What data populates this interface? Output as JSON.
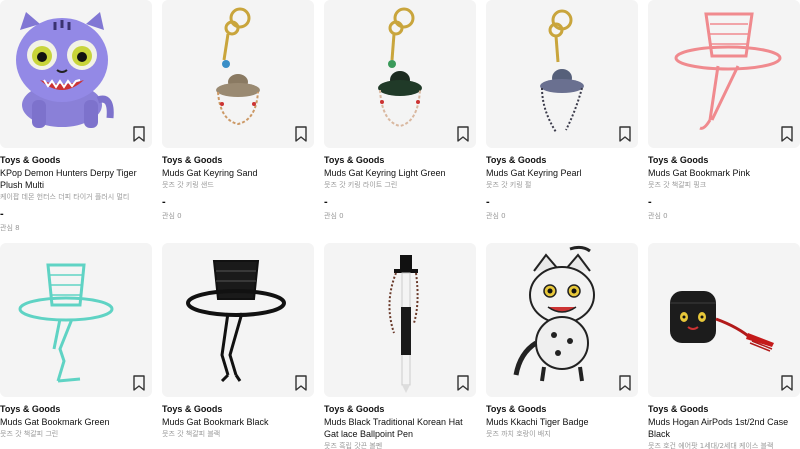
{
  "products": [
    {
      "category": "Toys & Goods",
      "name": "KPop Demon Hunters Derpy Tiger Plush Multi",
      "name_ko": "케이팝 데몬 헌터스 더피 타이거 플러시 멀티",
      "price": "-",
      "interest": "관심 8",
      "icon": "tiger-plush"
    },
    {
      "category": "Toys & Goods",
      "name": "Muds Gat Keyring Sand",
      "name_ko": "뭇즈 갓 키링 샌드",
      "price": "-",
      "interest": "관심 0",
      "icon": "gat-keyring"
    },
    {
      "category": "Toys & Goods",
      "name": "Muds Gat Keyring Light Green",
      "name_ko": "뭇즈 갓 키링 라이트 그린",
      "price": "-",
      "interest": "관심 0",
      "icon": "gat-keyring"
    },
    {
      "category": "Toys & Goods",
      "name": "Muds Gat Keyring Pearl",
      "name_ko": "뭇즈 갓 키링 펄",
      "price": "-",
      "interest": "관심 0",
      "icon": "gat-keyring"
    },
    {
      "category": "Toys & Goods",
      "name": "Muds Gat Bookmark Pink",
      "name_ko": "뭇즈 갓 책갈피 핑크",
      "price": "-",
      "interest": "관심 0",
      "icon": "gat-bookmark",
      "color": "#f08a8e"
    },
    {
      "category": "Toys & Goods",
      "name": "Muds Gat Bookmark Green",
      "name_ko": "뭇즈 갓 책갈피 그린",
      "price": "-",
      "interest": "",
      "icon": "gat-bookmark",
      "color": "#5fd3c4"
    },
    {
      "category": "Toys & Goods",
      "name": "Muds Gat Bookmark Black",
      "name_ko": "뭇즈 갓 책갈피 블랙",
      "price": "-",
      "interest": "",
      "icon": "gat-bookmark",
      "color": "#111111"
    },
    {
      "category": "Toys & Goods",
      "name": "Muds Black Traditional Korean Hat Gat lace Ballpoint Pen",
      "name_ko": "뭇즈 흑립 갓끈 볼펜",
      "price": "",
      "interest": "",
      "icon": "gat-pen"
    },
    {
      "category": "Toys & Goods",
      "name": "Muds Kkachi Tiger Badge",
      "name_ko": "뭇즈 까치 호랑이 배지",
      "price": "-",
      "interest": "",
      "icon": "tiger-badge"
    },
    {
      "category": "Toys & Goods",
      "name": "Muds Hogan AirPods 1st/2nd Case Black",
      "name_ko": "뭇즈 호건 에어팟 1세대/2세대 케이스 블랙",
      "price": "",
      "interest": "",
      "icon": "airpods-case"
    }
  ],
  "colors": {
    "thumb_bg": "#f4f4f4",
    "category": "#111111",
    "meta": "#999999"
  }
}
